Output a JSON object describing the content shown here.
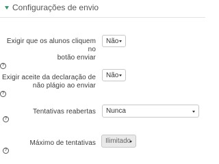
{
  "section": {
    "title": "Configurações de envio"
  },
  "fields": {
    "require_submit": {
      "label_line1": "Exigir que os alunos cliquem no",
      "label_line2": "botão enviar",
      "value": "Não",
      "help_glyph": "?"
    },
    "require_declaration": {
      "label_line1": "Exigir aceite da declaração de",
      "label_line2": "não plágio ao enviar",
      "value": "Não",
      "help_glyph": "?"
    },
    "reopened_attempts": {
      "label": "Tentativas reabertas",
      "value": "Nunca",
      "help_glyph": "?"
    },
    "max_attempts": {
      "label": "Máximo de tentativas",
      "value": "Ilimitado",
      "help_glyph": "?"
    }
  },
  "colors": {
    "caret": "#2e9a6a",
    "disabled_bg": "#e9e9e9"
  }
}
